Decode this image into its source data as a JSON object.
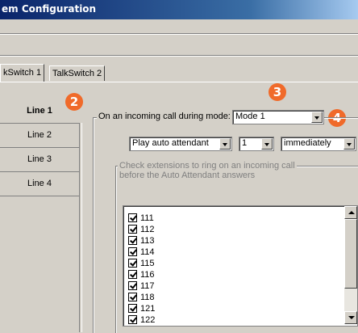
{
  "window": {
    "title": "em Configuration"
  },
  "tabs": [
    {
      "label": "kSwitch 1"
    },
    {
      "label": "TalkSwitch 2"
    }
  ],
  "lines": [
    {
      "label": "Line 1"
    },
    {
      "label": "Line 2"
    },
    {
      "label": "Line 3"
    },
    {
      "label": "Line 4"
    }
  ],
  "badges": {
    "b2": "2",
    "b3": "3",
    "b4": "4"
  },
  "mode_group": {
    "label": "On an incoming call during mode:",
    "mode_value": "Mode 1",
    "action_value": "Play auto attendant",
    "number_value": "1",
    "timing_value": "immediately"
  },
  "extensions_group": {
    "label_line1": "Check extensions to ring on an incoming call",
    "label_line2": "before the Auto Attendant answers",
    "items": [
      {
        "label": "111",
        "checked": true
      },
      {
        "label": "112",
        "checked": true
      },
      {
        "label": "113",
        "checked": true
      },
      {
        "label": "114",
        "checked": true
      },
      {
        "label": "115",
        "checked": true
      },
      {
        "label": "116",
        "checked": true
      },
      {
        "label": "117",
        "checked": true
      },
      {
        "label": "118",
        "checked": true
      },
      {
        "label": "121",
        "checked": true
      },
      {
        "label": "122",
        "checked": true
      }
    ]
  },
  "colors": {
    "badge": "#f06a2a",
    "titlebar": "#0a246a",
    "face": "#d4d0c8"
  }
}
